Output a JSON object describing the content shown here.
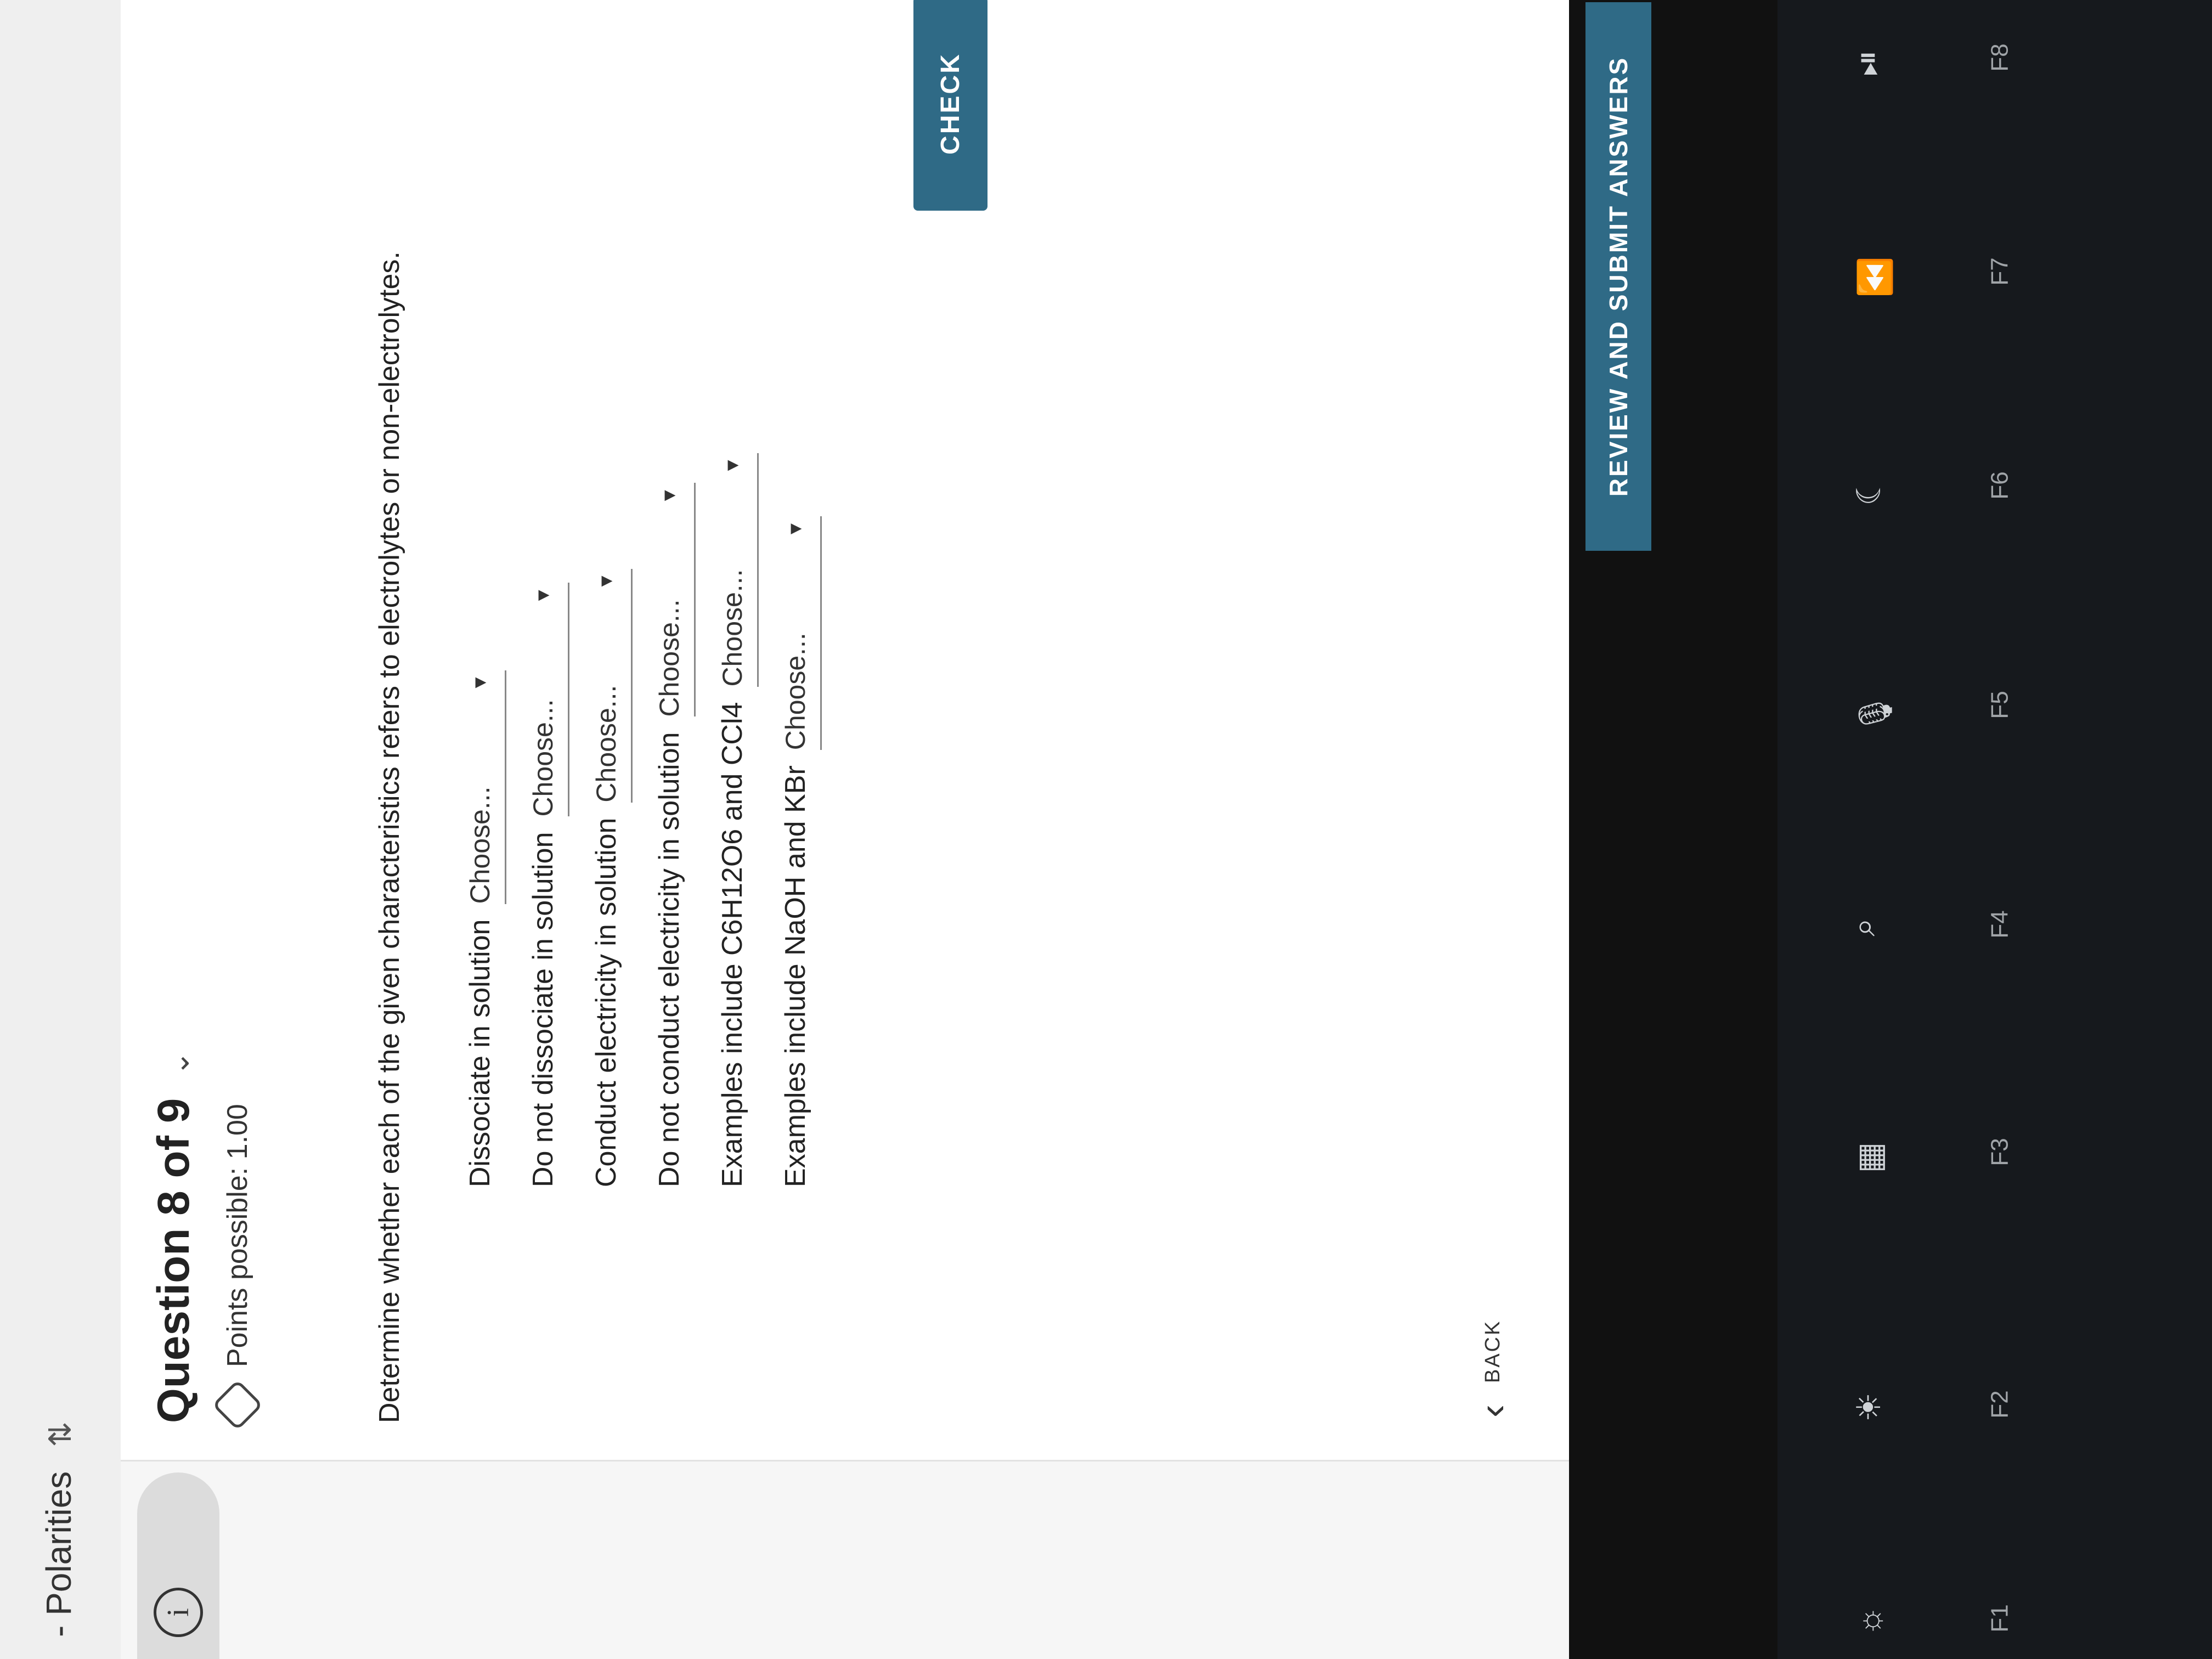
{
  "header": {
    "title": "- Polarities",
    "swap_icon": "swap-arrows-icon"
  },
  "question": {
    "title": "Question 8 of 9",
    "points_label": "Points possible: 1.00",
    "prompt": "Determine whether each of the given characteristics refers to electrolytes or non-electrolytes."
  },
  "rows": [
    {
      "label": "Dissociate in solution",
      "placeholder": "Choose..."
    },
    {
      "label": "Do not dissociate in solution",
      "placeholder": "Choose..."
    },
    {
      "label": "Conduct electricity in solution",
      "placeholder": "Choose..."
    },
    {
      "label": "Do not conduct electricity in solution",
      "placeholder": "Choose..."
    },
    {
      "label": "Examples include C6H12O6 and CCl4",
      "placeholder": "Choose..."
    },
    {
      "label": "Examples include NaOH and KBr",
      "placeholder": "Choose..."
    }
  ],
  "buttons": {
    "check": "CHECK",
    "back": "BACK",
    "review": "REVIEW AND SUBMIT ANSWERS"
  },
  "keyboard": {
    "keys": [
      {
        "label": "F1",
        "icon": "brightness-low-icon"
      },
      {
        "label": "F2",
        "icon": "brightness-high-icon"
      },
      {
        "label": "F3",
        "icon": "mission-control-icon"
      },
      {
        "label": "F4",
        "icon": "search-icon"
      },
      {
        "label": "F5",
        "icon": "microphone-icon"
      },
      {
        "label": "F6",
        "icon": "moon-icon"
      },
      {
        "label": "F7",
        "icon": "rewind-icon"
      },
      {
        "label": "F8",
        "icon": "play-pause-icon"
      }
    ]
  }
}
